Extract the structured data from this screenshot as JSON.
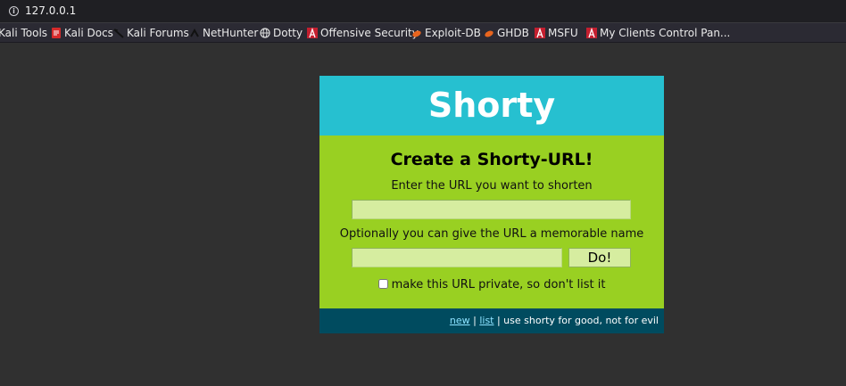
{
  "browser": {
    "url": "127.0.0.1",
    "bookmarks": [
      {
        "label": "Kali Tools",
        "icon": "kali-dragon-icon"
      },
      {
        "label": "Kali Docs",
        "icon": "kali-docs-icon"
      },
      {
        "label": "Kali Forums",
        "icon": "kali-dragon-icon"
      },
      {
        "label": "NetHunter",
        "icon": "nethunter-icon"
      },
      {
        "label": "Dotty",
        "icon": "globe-icon"
      },
      {
        "label": "Offensive Security",
        "icon": "offsec-icon"
      },
      {
        "label": "Exploit-DB",
        "icon": "exploit-db-icon"
      },
      {
        "label": "GHDB",
        "icon": "ghdb-icon"
      },
      {
        "label": "MSFU",
        "icon": "offsec-icon"
      },
      {
        "label": "My Clients Control Pan...",
        "icon": "offsec-icon"
      }
    ]
  },
  "app": {
    "title": "Shorty",
    "form": {
      "heading": "Create a Shorty-URL!",
      "url_label": "Enter the URL you want to shorten",
      "url_value": "",
      "name_label": "Optionally you can give the URL a memorable name",
      "name_value": "",
      "submit_label": "Do!",
      "private_label": "make this URL private, so don't list it",
      "private_checked": false
    },
    "footer": {
      "new_link": "new",
      "sep1": " | ",
      "list_link": "list",
      "tagline": " | use shorty for good, not for evil"
    }
  },
  "colors": {
    "header": "#26c0d0",
    "body": "#99d022",
    "footer": "#004b5f",
    "page_background": "#303030"
  }
}
